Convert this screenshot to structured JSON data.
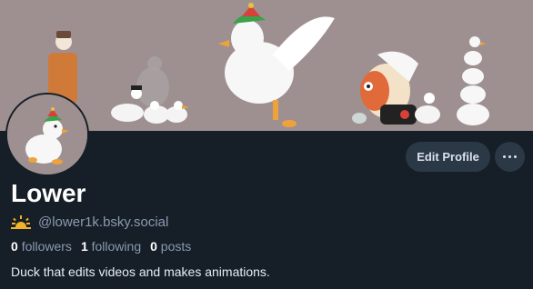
{
  "profile": {
    "display_name": "Lower",
    "handle": "@lower1k.bsky.social",
    "bio": "Duck that edits videos and makes animations.",
    "followers_count": "0",
    "followers_label": "followers",
    "following_count": "1",
    "following_label": "following",
    "posts_count": "0",
    "posts_label": "posts"
  },
  "actions": {
    "edit_profile_label": "Edit Profile",
    "more_icon": "ellipsis-icon"
  },
  "icons": {
    "handle_badge": "sun-icon"
  },
  "colors": {
    "background": "#161e27",
    "banner": "#9e9090",
    "button": "#2b3846",
    "muted_text": "#8a9bb0"
  }
}
